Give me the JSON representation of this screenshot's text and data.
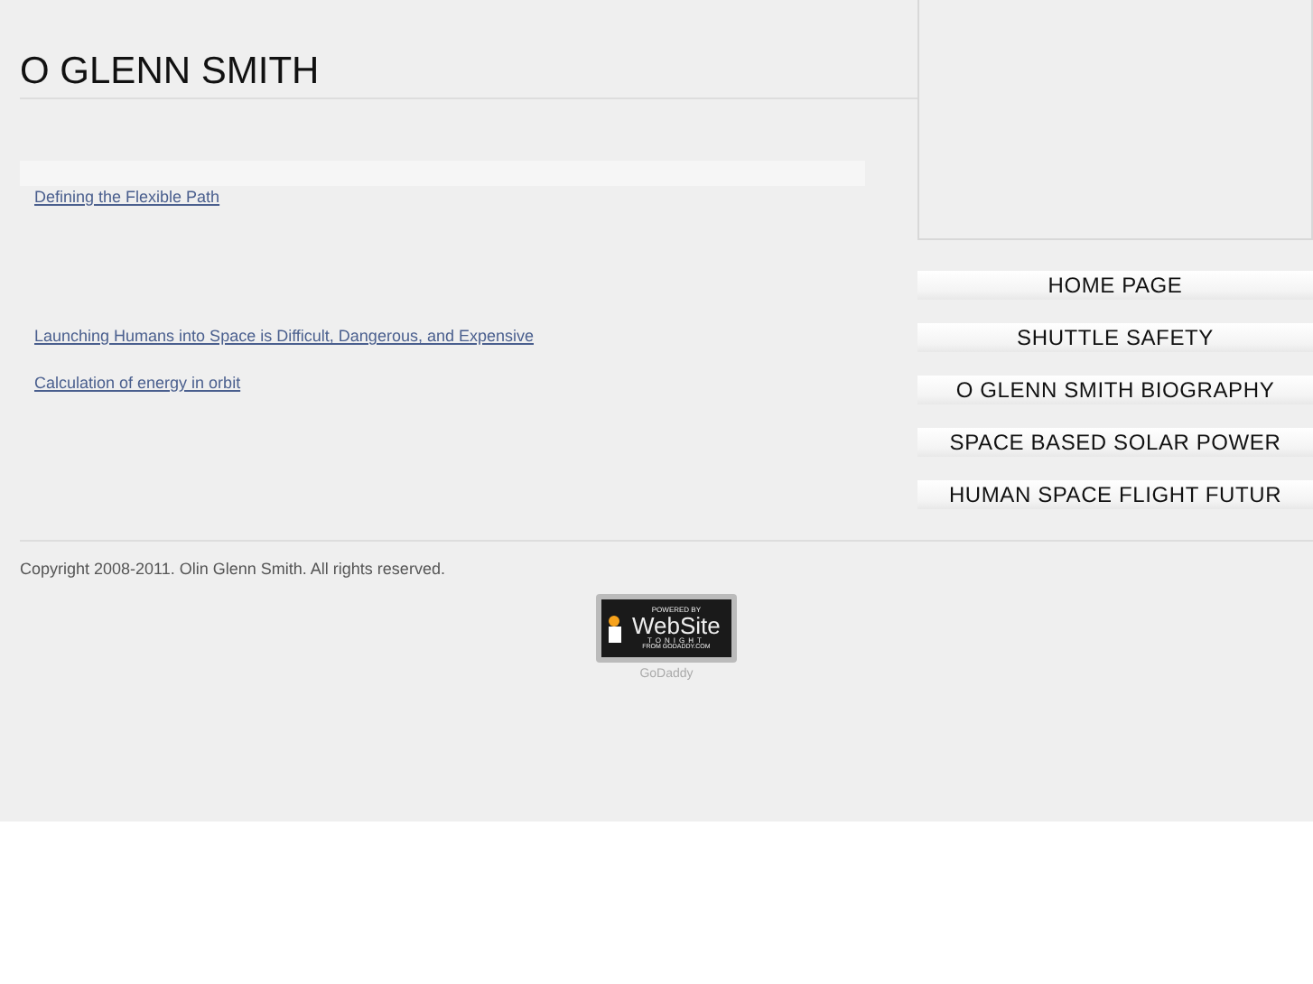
{
  "site_title": "O GLENN SMITH",
  "articles": [
    {
      "title": "Defining the Flexible Path"
    },
    {
      "title": "Launching Humans into Space is Difficult, Dangerous, and Expensive"
    },
    {
      "title": "Calculation of energy in orbit"
    }
  ],
  "nav": [
    {
      "label": "HOME PAGE"
    },
    {
      "label": "SHUTTLE SAFETY"
    },
    {
      "label": "O GLENN SMITH BIOGRAPHY"
    },
    {
      "label": "SPACE BASED SOLAR POWER"
    },
    {
      "label": "HUMAN SPACE FLIGHT FUTUR"
    }
  ],
  "footer": {
    "copyright": "Copyright 2008-2011. Olin Glenn Smith. All rights reserved.",
    "badge": {
      "top": "POWERED BY",
      "main": "WebSite",
      "sub": "TONIGHT",
      "bottom": "FROM GODADDY.COM"
    },
    "badge_caption": "GoDaddy"
  }
}
